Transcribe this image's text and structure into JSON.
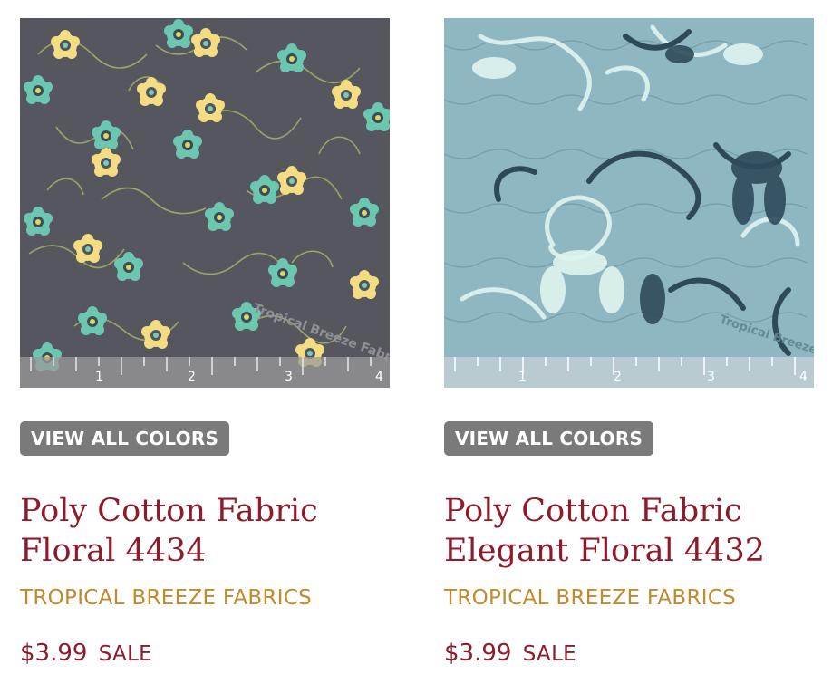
{
  "products": [
    {
      "image_alt": "Poly Cotton Fabric Floral 4434 swatch",
      "colors_button": "VIEW ALL COLORS",
      "title_line1": "Poly Cotton Fabric",
      "title_line2": "Floral 4434",
      "vendor": "TROPICAL BREEZE FABRICS",
      "price": "$3.99",
      "sale_label": "SALE",
      "swatch_background": "#56565e",
      "ruler_labels": [
        "1",
        "2",
        "3",
        "4"
      ],
      "watermark": "Tropical Breeze Fabrics"
    },
    {
      "image_alt": "Poly Cotton Fabric Elegant Floral 4432 swatch",
      "colors_button": "VIEW ALL COLORS",
      "title_line1": "Poly Cotton Fabric",
      "title_line2": "Elegant Floral 4432",
      "vendor": "TROPICAL BREEZE FABRICS",
      "price": "$3.99",
      "sale_label": "SALE",
      "swatch_background": "#8fb7c2",
      "ruler_labels": [
        "1",
        "2",
        "3",
        "4"
      ],
      "watermark": "Tropical Breeze Fabrics"
    }
  ],
  "colors": {
    "title": "#8e1b2c",
    "vendor": "#c28a2e",
    "price": "#8e1b2c",
    "button_bg": "#7a7a7a",
    "button_text": "#ffffff"
  }
}
